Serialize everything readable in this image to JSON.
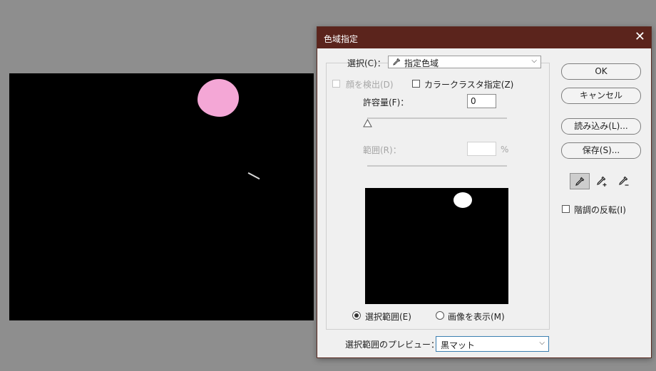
{
  "dialog": {
    "title": "色域指定",
    "close_glyph": "✕",
    "select_label": "選択(C)：",
    "select_value": "指定色域",
    "select_icon": "eyedropper-icon",
    "detect_faces": "顔を検出(D)",
    "localized_clusters": "カラークラスタ指定(Z)",
    "fuzziness_label": "許容量(F)：",
    "fuzziness_value": "0",
    "range_label": "範囲(R)：",
    "range_value": "",
    "range_unit": "%",
    "radio_selection": "選択範囲(E)",
    "radio_image": "画像を表示(M)",
    "preview_label": "選択範囲のプレビュー：",
    "preview_value": "黒マット",
    "buttons": {
      "ok": "OK",
      "cancel": "キャンセル",
      "load": "読み込み(L)...",
      "save": "保存(S)..."
    },
    "invert_label": "階調の反転(I)",
    "tools": [
      "eyedropper-icon",
      "eyedropper-plus-icon",
      "eyedropper-minus-icon"
    ]
  },
  "canvas": {
    "background": "#000000",
    "blob_color": "#f4a7d6"
  },
  "colors": {
    "titlebar": "#5b241c",
    "workspace": "#8e8e8e",
    "dialog_bg": "#f0f0f0"
  }
}
